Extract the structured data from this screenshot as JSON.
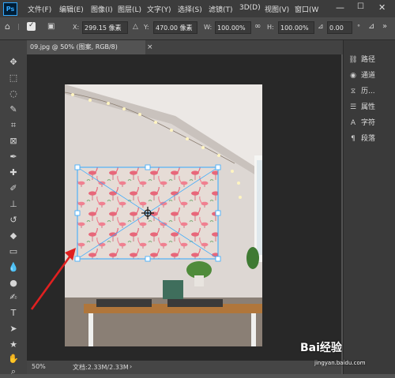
{
  "app": {
    "logo": "Ps"
  },
  "menu": [
    "文件(F)",
    "编辑(E)",
    "图像(I)",
    "图层(L)",
    "文字(Y)",
    "选择(S)",
    "滤镜(T)",
    "3D(D)",
    "视图(V)",
    "窗口(W"
  ],
  "options": {
    "x_label": "X:",
    "x_value": "299.15 像素",
    "y_label": "Y:",
    "y_value": "470.00 像素",
    "w_label": "W:",
    "w_value": "100.00%",
    "h_label": "H:",
    "h_value": "100.00%",
    "angle_value": "0.00"
  },
  "document": {
    "tab_title": "09.jpg @ 50% (图案, RGB/8)",
    "close": "×"
  },
  "status": {
    "zoom": "50%",
    "doc_size": "文档:2.33M/2.33M"
  },
  "panels": [
    {
      "icon": "history-icon",
      "label": "路径"
    },
    {
      "icon": "channels-icon",
      "label": "通道"
    },
    {
      "icon": "history-icon",
      "label": "历..."
    },
    {
      "icon": "properties-icon",
      "label": "属性"
    },
    {
      "icon": "character-icon",
      "label": "字符"
    },
    {
      "icon": "paragraph-icon",
      "label": "段落"
    }
  ],
  "watermark": {
    "text": "Bai经验",
    "url": "jingyan.baidu.com"
  },
  "colors": {
    "accent": "#31a8ff",
    "arrow": "#e02020",
    "pattern_bg": "#e8dcd6",
    "flamingo": "#e8677a"
  }
}
